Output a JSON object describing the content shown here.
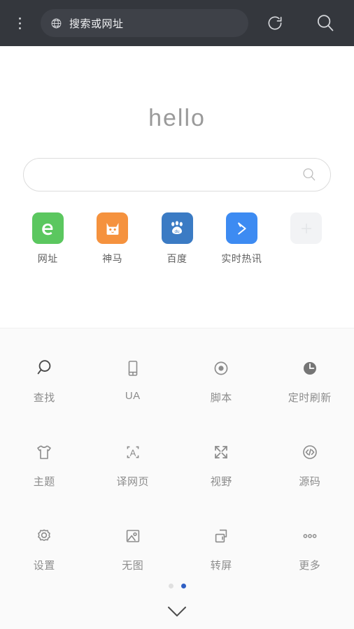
{
  "topbar": {
    "menu_icon": "more-vertical-icon",
    "address": {
      "icon": "globe-icon",
      "value": "",
      "placeholder": "搜索或网址"
    },
    "refresh_icon": "refresh-icon",
    "search_icon": "search-icon",
    "bar_color": "#34373D",
    "pill_color": "#3E4148"
  },
  "hero": {
    "greeting": "hello",
    "search": {
      "value": "",
      "placeholder": "",
      "icon": "search-icon"
    }
  },
  "shortcuts": [
    {
      "label": "网址",
      "icon": "e-logo-icon",
      "color": "#5BC75F"
    },
    {
      "label": "神马",
      "icon": "shenma-cat-icon",
      "color": "#F5923E"
    },
    {
      "label": "百度",
      "icon": "baidu-paw-icon",
      "color": "#3B7BC4"
    },
    {
      "label": "实时热讯",
      "icon": "arrow-chevron-icon",
      "color": "#3D8BF2"
    },
    {
      "label": "",
      "icon": "plus-icon",
      "color": "#F2F3F5"
    }
  ],
  "tools": [
    [
      {
        "label": "查找",
        "icon": "magnifier-icon"
      },
      {
        "label": "UA",
        "icon": "phone-icon"
      },
      {
        "label": "脚本",
        "icon": "target-dot-icon"
      },
      {
        "label": "定时刷新",
        "icon": "clock-icon"
      }
    ],
    [
      {
        "label": "主题",
        "icon": "tshirt-icon"
      },
      {
        "label": "译网页",
        "icon": "translate-a-icon"
      },
      {
        "label": "视野",
        "icon": "expand-arrows-icon"
      },
      {
        "label": "源码",
        "icon": "code-circle-icon"
      }
    ],
    [
      {
        "label": "设置",
        "icon": "gear-icon"
      },
      {
        "label": "无图",
        "icon": "image-icon"
      },
      {
        "label": "转屏",
        "icon": "rotate-screen-icon"
      },
      {
        "label": "更多",
        "icon": "more-dots-icon"
      }
    ]
  ],
  "footer": {
    "pages": 2,
    "active_page": 2,
    "active_dot_color": "#2F5FC4",
    "collapse_icon": "chevron-down-icon"
  }
}
